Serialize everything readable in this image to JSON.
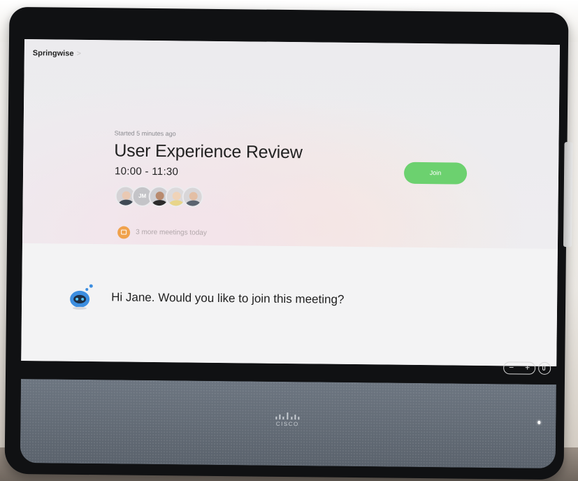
{
  "header": {
    "brand": "Springwise",
    "chevron": ">"
  },
  "meeting": {
    "status": "Started 5 minutes ago",
    "title": "User Experience Review",
    "time": "10:00 - 11:30",
    "join_label": "Join",
    "participants": [
      {
        "type": "photo",
        "skin": "#e9c9b3",
        "clothing": "#3f4a55"
      },
      {
        "type": "initials",
        "initials": "JM",
        "color": "#c4c4c8"
      },
      {
        "type": "photo",
        "skin": "#b88a6e",
        "clothing": "#2b2b2b"
      },
      {
        "type": "photo",
        "skin": "#f0d3b8",
        "clothing": "#e8d58a"
      },
      {
        "type": "photo",
        "skin": "#e3bfa5",
        "clothing": "#5b6470"
      }
    ]
  },
  "more_meetings": {
    "icon": "calendar-icon",
    "text": "3 more meetings today",
    "accent": "#f0a24c"
  },
  "assistant": {
    "icon": "bot-icon",
    "message": "Hi Jane. Would you like to join this meeting?"
  },
  "hardware_controls": {
    "volume_down": "−",
    "volume_up": "+",
    "mute_icon": "mic-icon"
  },
  "device": {
    "brand": "CISCO"
  },
  "colors": {
    "join": "#6cd16f",
    "bot": "#3d8ee0",
    "speaker": "#626b75"
  }
}
